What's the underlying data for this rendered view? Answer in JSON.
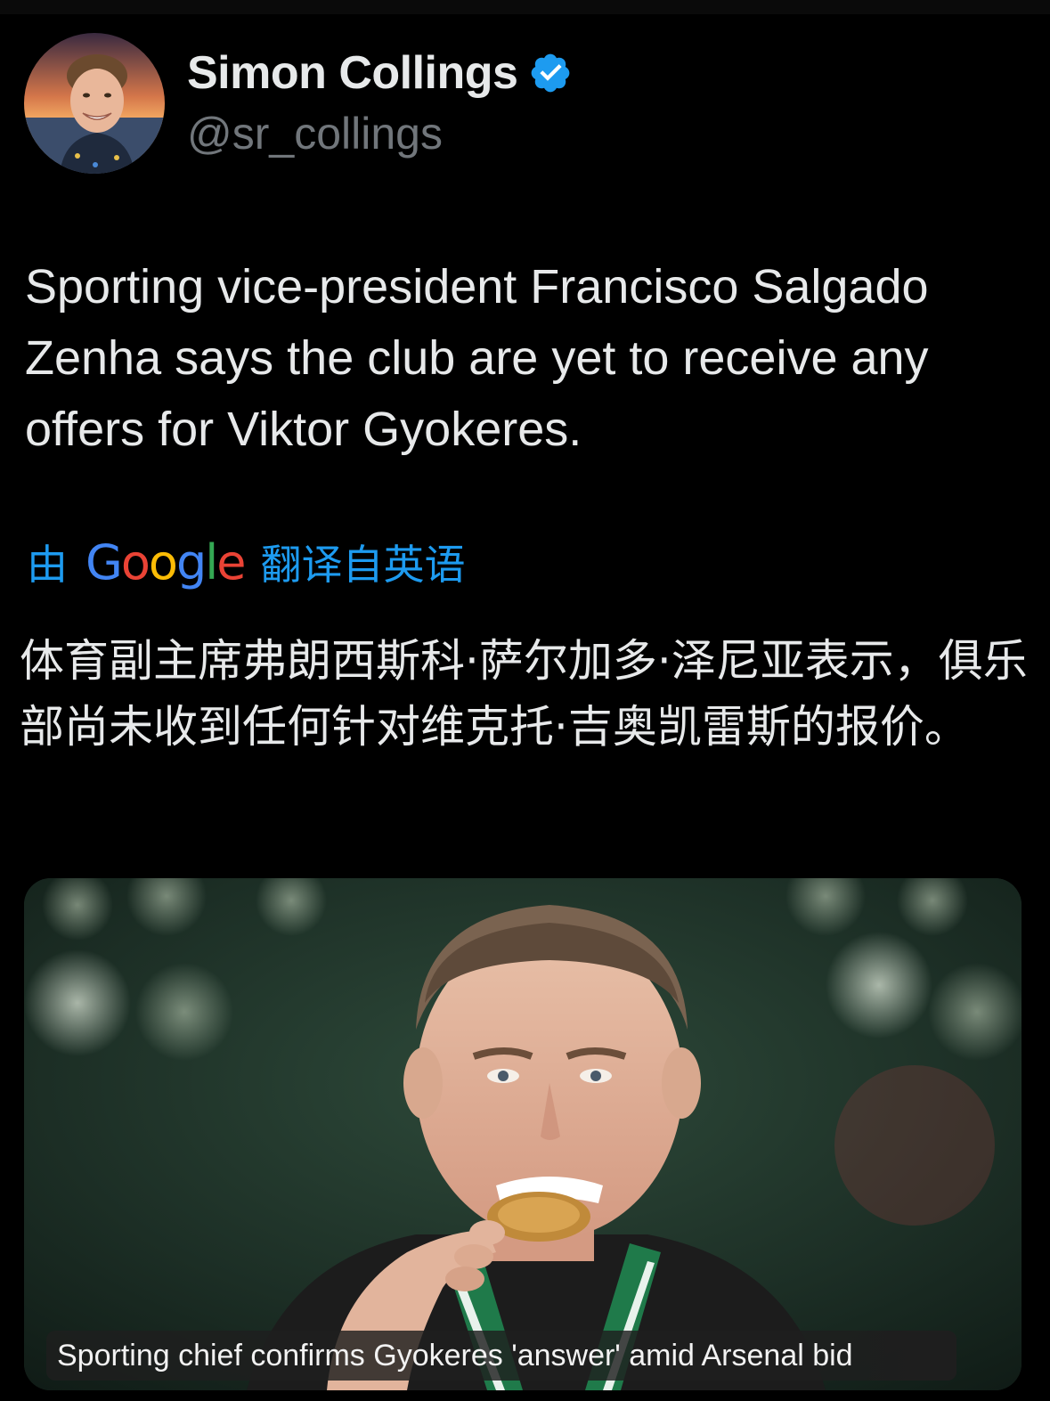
{
  "tweet": {
    "author": {
      "display_name": "Simon Collings",
      "handle": "@sr_collings",
      "verified": true,
      "verified_color": "#1d9bf0"
    },
    "text": "Sporting vice-president Francisco Salgado Zenha says the club are yet to receive any offers for Viktor Gyokeres.",
    "translation": {
      "prefix": "由",
      "provider": "Google",
      "suffix": "翻译自英语",
      "text": "体育副主席弗朗西斯科·萨尔加多·泽尼亚表示，俱乐部尚未收到任何针对维克托·吉奥凯雷斯的报价。"
    },
    "media": {
      "caption": "Sporting chief confirms Gyokeres 'answer' amid Arsenal bid"
    }
  },
  "colors": {
    "background": "#000000",
    "text_primary": "#e7e9ea",
    "text_secondary": "#71767b",
    "link_blue": "#1d9bf0"
  }
}
